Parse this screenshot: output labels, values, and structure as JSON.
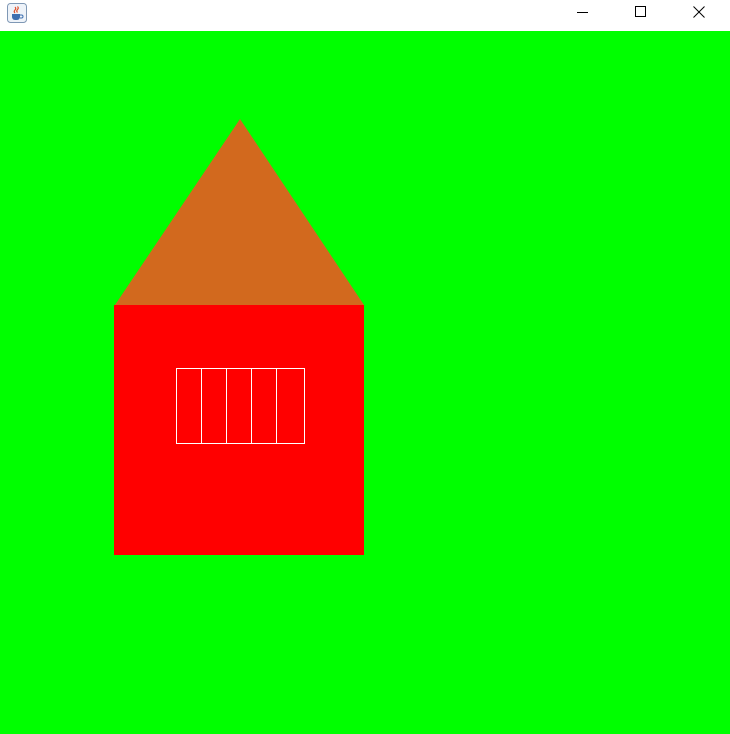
{
  "window": {
    "title": "",
    "app_icon": "java-coffee-cup-icon",
    "controls": {
      "minimize_icon": "minimize-icon",
      "maximize_icon": "maximize-icon",
      "close_icon": "close-icon"
    }
  },
  "scene": {
    "background_color": "#00ff00",
    "roof_color": "#d2691e",
    "wall_color": "#ff0000",
    "window_outline_color": "#ffffff",
    "window_panes": 5
  }
}
